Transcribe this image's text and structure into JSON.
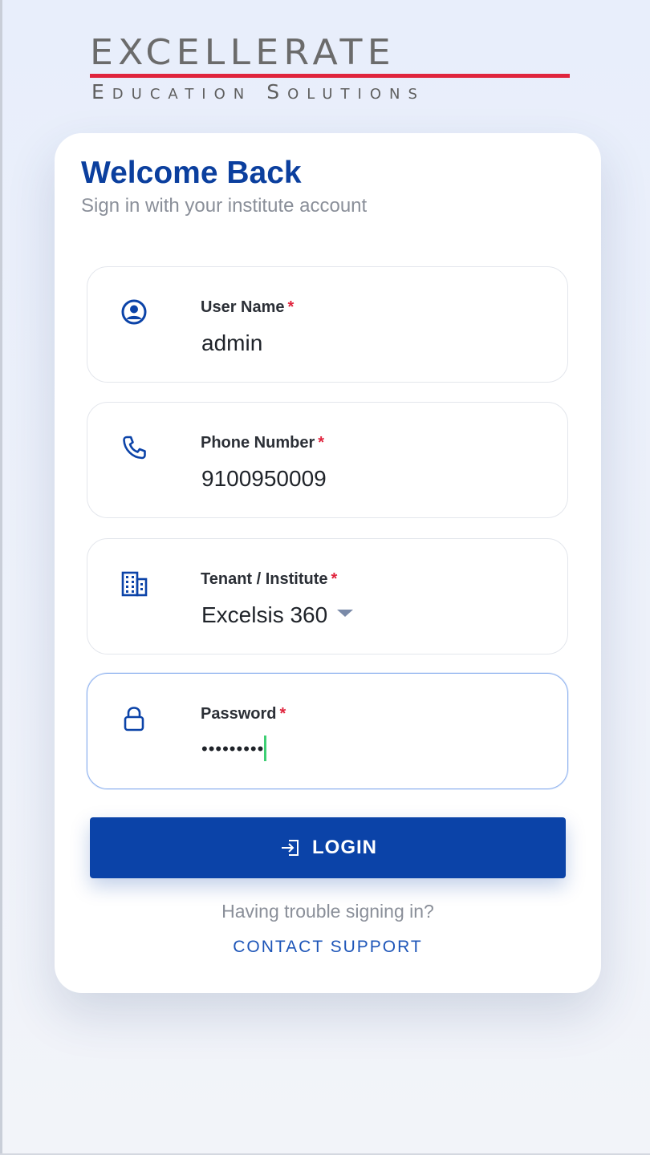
{
  "brand": {
    "name": "EXCELLERATE",
    "tagline": "Education Solutions"
  },
  "card": {
    "title": "Welcome Back",
    "subtitle": "Sign in with your institute account"
  },
  "form": {
    "username": {
      "label": "User Name",
      "required_mark": "*",
      "value": "admin",
      "icon": "account-circle-icon"
    },
    "phone": {
      "label": "Phone Number",
      "required_mark": "*",
      "value": "9100950009",
      "icon": "phone-icon"
    },
    "tenant": {
      "label": "Tenant / Institute",
      "required_mark": "*",
      "value": "Excelsis 360",
      "icon": "building-icon"
    },
    "password": {
      "label": "Password",
      "required_mark": "*",
      "masked_value": "•••••••••",
      "icon": "lock-icon",
      "focused": true
    }
  },
  "login_button": {
    "label": "LOGIN",
    "icon": "login-icon"
  },
  "help": {
    "trouble_text": "Having trouble signing in?",
    "support_link": "CONTACT SUPPORT"
  },
  "colors": {
    "primary": "#0b43a8",
    "title": "#0b3f9e",
    "accent_red": "#e0243d",
    "caret": "#3ecf74"
  }
}
